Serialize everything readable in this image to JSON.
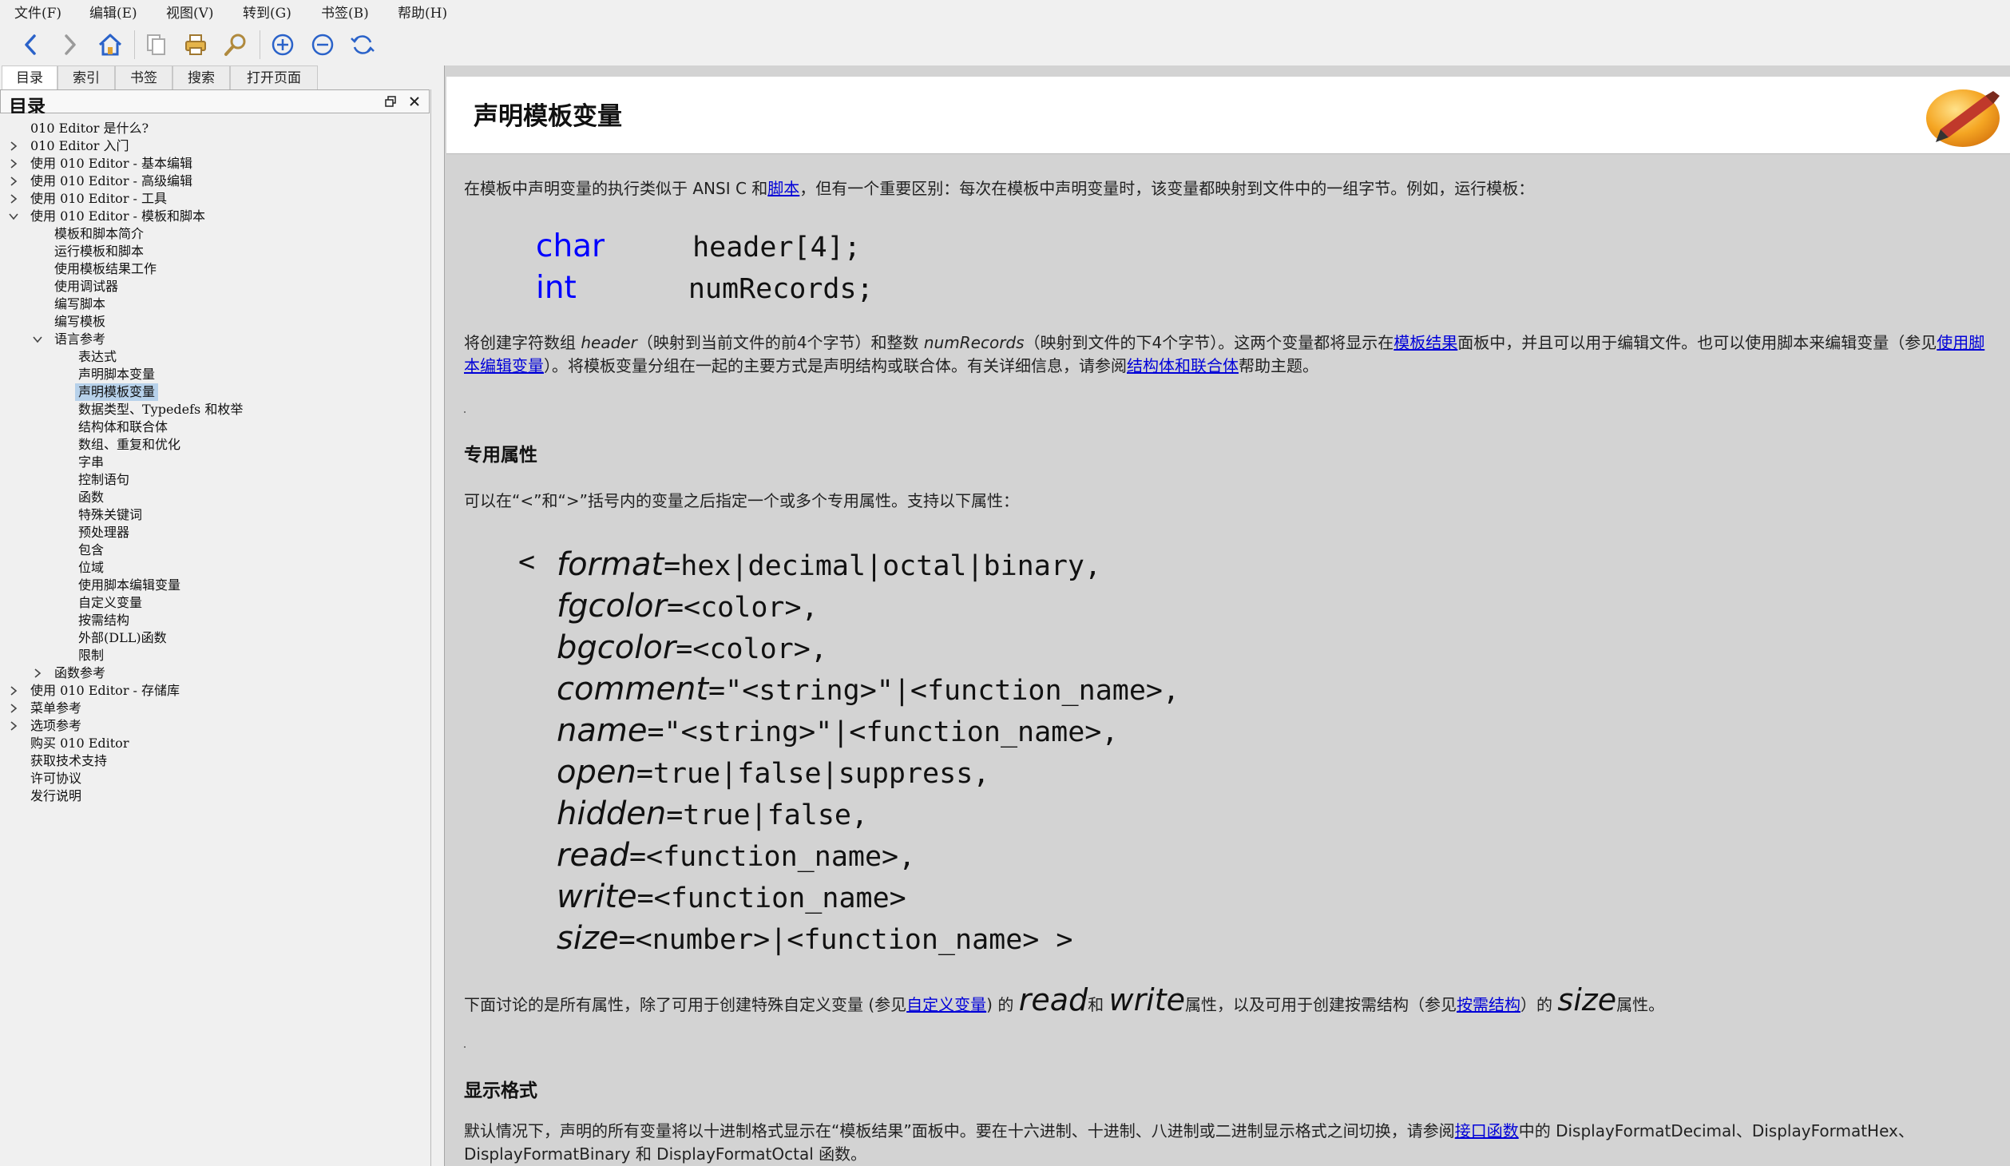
{
  "menu": [
    "文件(F)",
    "编辑(E)",
    "视图(V)",
    "转到(G)",
    "书签(B)",
    "帮助(H)"
  ],
  "toolbar": {
    "icons": [
      "back-arrow",
      "forward-arrow",
      "home",
      "copy-page",
      "print",
      "find",
      "zoom-in",
      "zoom-out",
      "refresh"
    ]
  },
  "tabs": [
    "目录",
    "索引",
    "书签",
    "搜索",
    "打开页面"
  ],
  "left_panel": {
    "title": "目录",
    "tree": [
      {
        "label": "010 Editor 是什么?",
        "arrow": ""
      },
      {
        "label": "010 Editor 入门",
        "arrow": "collapsed"
      },
      {
        "label": "使用 010 Editor - 基本编辑",
        "arrow": "collapsed"
      },
      {
        "label": "使用 010 Editor - 高级编辑",
        "arrow": "collapsed"
      },
      {
        "label": "使用 010 Editor - 工具",
        "arrow": "collapsed"
      },
      {
        "label": "使用 010 Editor - 模板和脚本",
        "arrow": "expanded"
      },
      {
        "label": "模板和脚本简介",
        "arrow": ""
      },
      {
        "label": "运行模板和脚本",
        "arrow": ""
      },
      {
        "label": "使用模板结果工作",
        "arrow": ""
      },
      {
        "label": "使用调试器",
        "arrow": ""
      },
      {
        "label": "编写脚本",
        "arrow": ""
      },
      {
        "label": "编写模板",
        "arrow": ""
      },
      {
        "label": "语言参考",
        "arrow": "expanded"
      },
      {
        "label": "表达式",
        "arrow": ""
      },
      {
        "label": "声明脚本变量",
        "arrow": ""
      },
      {
        "label": "声明模板变量",
        "arrow": "",
        "selected": true
      },
      {
        "label": "数据类型、Typedefs 和枚举",
        "arrow": ""
      },
      {
        "label": "结构体和联合体",
        "arrow": ""
      },
      {
        "label": "数组、重复和优化",
        "arrow": ""
      },
      {
        "label": "字串",
        "arrow": ""
      },
      {
        "label": "控制语句",
        "arrow": ""
      },
      {
        "label": "函数",
        "arrow": ""
      },
      {
        "label": "特殊关键词",
        "arrow": ""
      },
      {
        "label": "预处理器",
        "arrow": ""
      },
      {
        "label": "包含",
        "arrow": ""
      },
      {
        "label": "位域",
        "arrow": ""
      },
      {
        "label": "使用脚本编辑变量",
        "arrow": ""
      },
      {
        "label": "自定义变量",
        "arrow": ""
      },
      {
        "label": "按需结构",
        "arrow": ""
      },
      {
        "label": "外部(DLL)函数",
        "arrow": ""
      },
      {
        "label": "限制",
        "arrow": ""
      },
      {
        "label": "函数参考",
        "arrow": "collapsed"
      },
      {
        "label": "使用 010 Editor - 存储库",
        "arrow": "collapsed"
      },
      {
        "label": "菜单参考",
        "arrow": "collapsed"
      },
      {
        "label": "选项参考",
        "arrow": "collapsed"
      },
      {
        "label": "购买 010 Editor",
        "arrow": ""
      },
      {
        "label": "获取技术支持",
        "arrow": ""
      },
      {
        "label": "许可协议",
        "arrow": ""
      },
      {
        "label": "发行说明",
        "arrow": ""
      }
    ]
  },
  "content": {
    "title": "声明模板变量",
    "intro": {
      "t1": "在模板中声明变量的执行类似于 ANSI C 和",
      "link1": "脚本",
      "t2": "，但有一个重要区别：每次在模板中声明变量时，该变量都映射到文件中的一组字节。例如，运行模板："
    },
    "code1": [
      {
        "keyword": "char",
        "rest": "header[4];"
      },
      {
        "keyword": "int",
        "rest": "numRecords;"
      }
    ],
    "para2": {
      "t1": "将创建字符数组 ",
      "i1": "header",
      "t2": "（映射到当前文件的前4个字节）和整数 ",
      "i2": "numRecords",
      "t3": "（映射到文件的下4个字节）。这两个变量都将显示在",
      "link1": "模板结果",
      "t4": "面板中，并且可以用于编辑文件。也可以使用脚本来编辑变量（参见",
      "link2a": "使用脚",
      "link2b": "本编辑变量",
      "t5": "）。将模板变量分组在一起的主要方式是声明结构或联合体。有关详细信息，请参阅",
      "link3": "结构体和联合体",
      "t6": "帮助主题。"
    },
    "section1": "专用属性",
    "para3": "可以在“<”和“>”括号内的变量之后指定一个或多个专用属性。支持以下属性：",
    "attrs_open": "<",
    "attrs": [
      {
        "name": "format",
        "value": "=hex|decimal|octal|binary,"
      },
      {
        "name": "fgcolor",
        "value": "=<color>,"
      },
      {
        "name": "bgcolor",
        "value": "=<color>,"
      },
      {
        "name": "comment",
        "value": "=\"<string>\"|<function_name>,"
      },
      {
        "name": "name",
        "value": "=\"<string>\"|<function_name>,"
      },
      {
        "name": "open",
        "value": "=true|false|suppress,"
      },
      {
        "name": "hidden",
        "value": "=true|false,"
      },
      {
        "name": "read",
        "value": "=<function_name>,"
      },
      {
        "name": "write",
        "value": "=<function_name>"
      },
      {
        "name": "size",
        "value": "=<number>|<function_name> >"
      }
    ],
    "para4": {
      "t1": "下面讨论的是所有属性，除了可用于创建特殊自定义变量 (参见",
      "link1": "自定义变量",
      "t2": ") 的 ",
      "i1": "read",
      "t3": "和 ",
      "i2": "write",
      "t4": "属性，以及可用于创建按需结构（参见",
      "link2": "按需结构",
      "t5": "）的 ",
      "i3": "size",
      "t6": "属性。"
    },
    "section2": "显示格式",
    "para5": {
      "t1": "默认情况下，声明的所有变量将以十进制格式显示在“模板结果”面板中。要在十六进制、十进制、八进制或二进制显示格式之间切换，请参阅",
      "link1": "接口函数",
      "t2": "中的 DisplayFormatDecimal、DisplayFormatHex、",
      "t3": "DisplayFormatBinary 和 DisplayFormatOctal 函数。"
    }
  }
}
